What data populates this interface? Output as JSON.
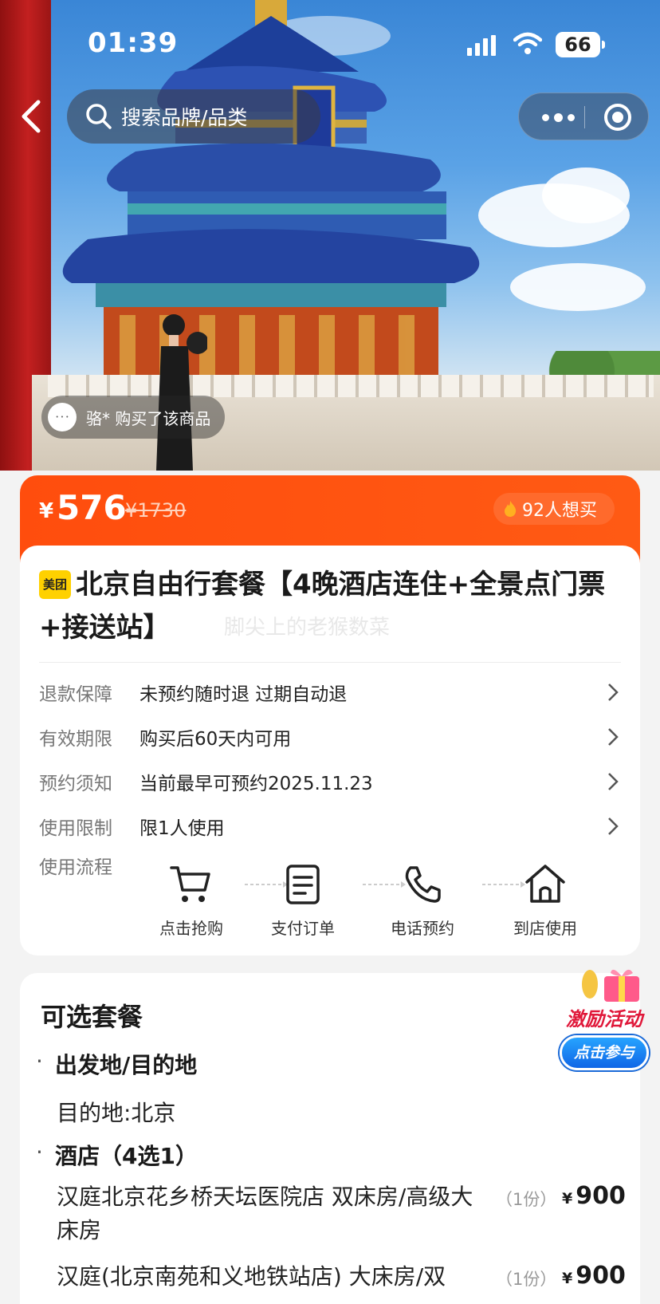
{
  "status_bar": {
    "time": "01:39",
    "battery": "66"
  },
  "nav": {
    "search_placeholder": "搜索品牌/品类"
  },
  "hero": {
    "buyer_text": "骆* 购买了该商品"
  },
  "price": {
    "currency": "¥",
    "current": "576",
    "original": "¥1730",
    "want_count": "92人想买"
  },
  "product": {
    "brand_badge": "美团",
    "title": "北京自由行套餐【4晚酒店连住+全景点门票+接送站】",
    "watermark": "脚尖上的老猴数菜"
  },
  "details": [
    {
      "key": "退款保障",
      "value": "未预约随时退 过期自动退"
    },
    {
      "key": "有效期限",
      "value": "购买后60天内可用"
    },
    {
      "key": "预约须知",
      "value": "当前最早可预约2025.11.23"
    },
    {
      "key": "使用限制",
      "value": "限1人使用"
    }
  ],
  "process": {
    "label": "使用流程",
    "steps": [
      {
        "label": "点击抢购",
        "icon": "cart-icon"
      },
      {
        "label": "支付订单",
        "icon": "order-icon"
      },
      {
        "label": "电话预约",
        "icon": "phone-icon"
      },
      {
        "label": "到店使用",
        "icon": "home-icon"
      }
    ]
  },
  "packages": {
    "title": "可选套餐",
    "section1": "出发地/目的地",
    "destination": "目的地:北京",
    "section2": "酒店（4选1）",
    "hotels": [
      {
        "name": "汉庭北京花乡桥天坛医院店 双床房/高级大床房",
        "qty": "（1份）",
        "currency": "¥",
        "price": "900"
      },
      {
        "name": "汉庭(北京南苑和义地铁站店) 大床房/双",
        "qty": "（1份）",
        "currency": "¥",
        "price": "900"
      }
    ]
  },
  "promo": {
    "title": "激励活动",
    "button": "点击参与"
  },
  "colors": {
    "accent": "#ff4d0d",
    "brand_yellow": "#ffd100",
    "promo_blue": "#1a6ad8"
  }
}
